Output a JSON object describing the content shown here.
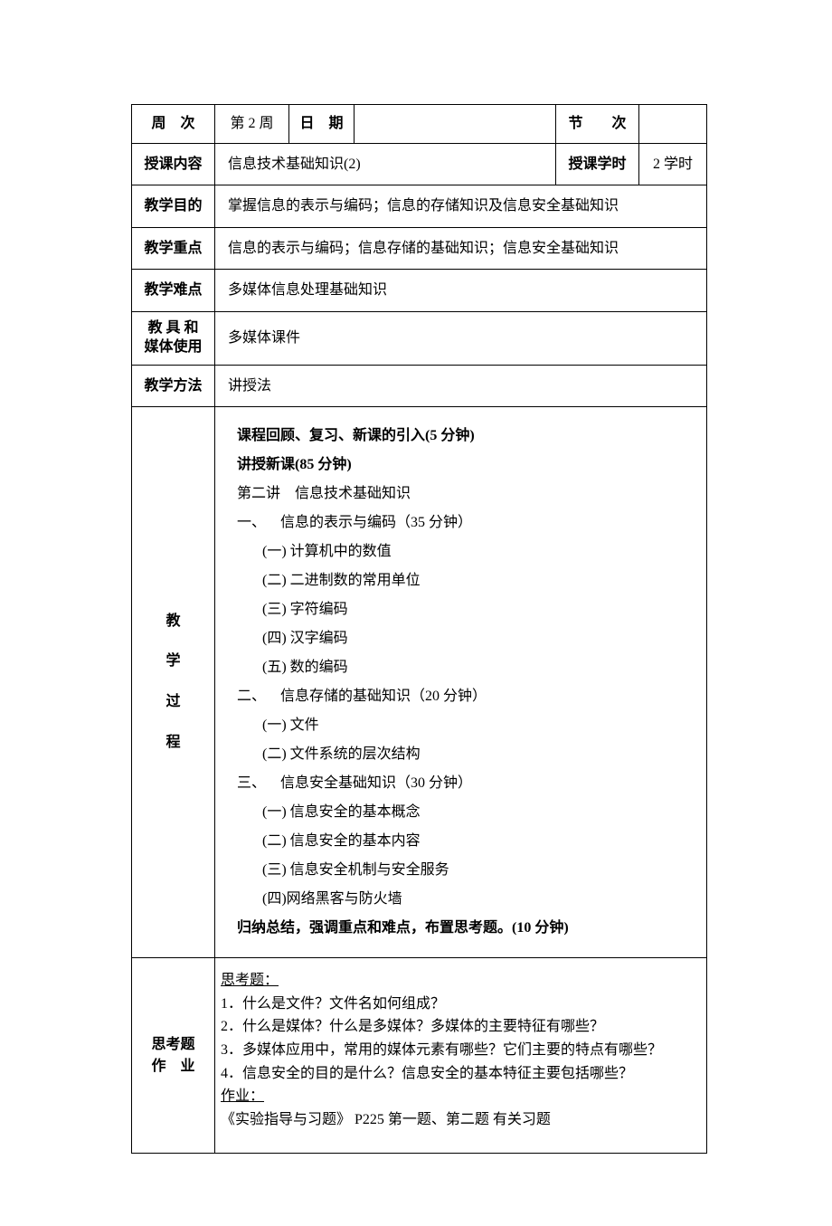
{
  "row1": {
    "label": "周　次",
    "week": "第 2 周",
    "date_label": "日　期",
    "date_val": "",
    "session_label": "节　　次",
    "session_val": ""
  },
  "row2": {
    "label": "授课内容",
    "content": "信息技术基础知识(2)",
    "hours_label": "授课学时",
    "hours_val": "2 学时"
  },
  "row3": {
    "label": "教学目的",
    "content": "掌握信息的表示与编码；信息的存储知识及信息安全基础知识"
  },
  "row4": {
    "label": "教学重点",
    "content": "信息的表示与编码；信息存储的基础知识；信息安全基础知识"
  },
  "row5": {
    "label": "教学难点",
    "content": "多媒体信息处理基础知识"
  },
  "row6": {
    "label_line1": "教 具 和",
    "label_line2": "媒体使用",
    "content": "多媒体课件"
  },
  "row7": {
    "label": "教学方法",
    "content": "讲授法"
  },
  "process": {
    "label_chars": [
      "教",
      "学",
      "过",
      "程"
    ],
    "lines": [
      {
        "text": "课程回顾、复习、新课的引入(5 分钟)",
        "bold": true,
        "indent": 0
      },
      {
        "text": "讲授新课(85 分钟)",
        "bold": true,
        "indent": 0
      },
      {
        "text": "第二讲　信息技术基础知识",
        "bold": false,
        "indent": 0
      },
      {
        "num": "一、",
        "text": "信息的表示与编码（35 分钟）",
        "indent": 0
      },
      {
        "text": "(一) 计算机中的数值",
        "indent": 2
      },
      {
        "text": "(二) 二进制数的常用单位",
        "indent": 2
      },
      {
        "text": "(三) 字符编码",
        "indent": 2
      },
      {
        "text": "(四) 汉字编码",
        "indent": 2
      },
      {
        "text": "(五) 数的编码",
        "indent": 2
      },
      {
        "num": "二、",
        "text": "信息存储的基础知识（20 分钟）",
        "indent": 0
      },
      {
        "text": "(一) 文件",
        "indent": 2
      },
      {
        "text": "(二) 文件系统的层次结构",
        "indent": 2
      },
      {
        "num": "三、",
        "text": "信息安全基础知识（30 分钟）",
        "indent": 0
      },
      {
        "text": "(一) 信息安全的基本概念",
        "indent": 2
      },
      {
        "text": "(二) 信息安全的基本内容",
        "indent": 2
      },
      {
        "text": "(三) 信息安全机制与安全服务",
        "indent": 2
      },
      {
        "text": "(四)网络黑客与防火墙",
        "indent": 2
      },
      {
        "text": "归纳总结，强调重点和难点，布置思考题。(10 分钟)",
        "bold": true,
        "indent": 0
      }
    ]
  },
  "homework": {
    "label_line1": "思考题",
    "label_line2": "作　业",
    "think_header": "思考题：",
    "think_items": [
      "1．什么是文件？文件名如何组成？",
      "2．什么是媒体？什么是多媒体？多媒体的主要特征有哪些？",
      "3．多媒体应用中，常用的媒体元素有哪些？它们主要的特点有哪些？",
      "4．信息安全的目的是什么？信息安全的基本特征主要包括哪些？"
    ],
    "hw_header": "作业：",
    "hw_text": "《实验指导与习题》 P225 第一题、第二题 有关习题"
  }
}
